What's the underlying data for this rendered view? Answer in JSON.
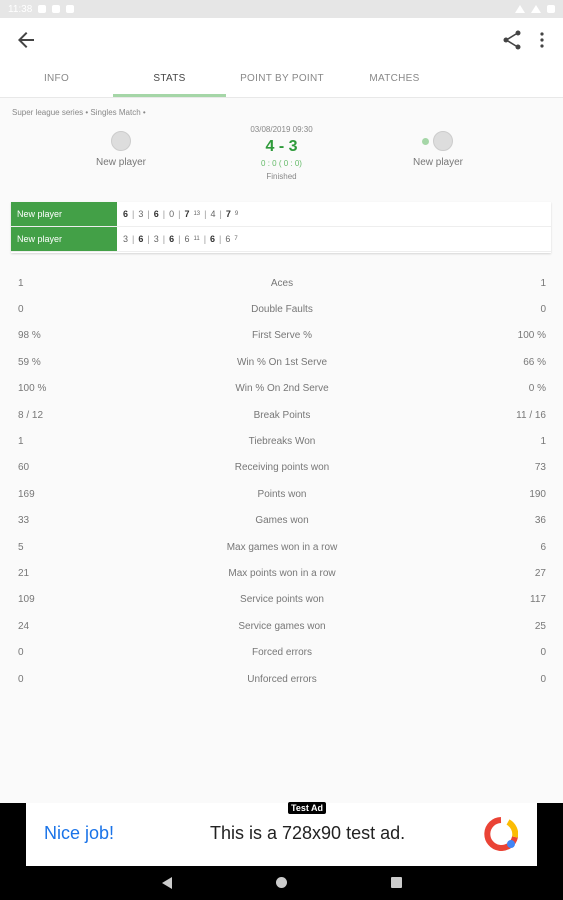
{
  "status_bar": {
    "time": "11:38"
  },
  "tabs": [
    "INFO",
    "STATS",
    "POINT BY POINT",
    "MATCHES"
  ],
  "breadcrumb": "Super league series • Singles Match •",
  "match": {
    "date": "03/08/2019 09:30",
    "score": "4 - 3",
    "subscore": "0 : 0 ( 0 : 0)",
    "status": "Finished",
    "player1": "New player",
    "player2": "New player"
  },
  "sets": [
    {
      "name": "New player",
      "games": [
        "6",
        "3",
        "6",
        "0",
        "7",
        "4",
        "7"
      ],
      "tiebreaks": {
        "4": "13",
        "6": "9"
      },
      "bold": [
        0,
        2,
        4,
        6
      ]
    },
    {
      "name": "New player",
      "games": [
        "3",
        "6",
        "3",
        "6",
        "6",
        "6",
        "6"
      ],
      "tiebreaks": {
        "4": "11",
        "6": "7"
      },
      "bold": [
        1,
        3,
        5
      ]
    }
  ],
  "stats": [
    {
      "label": "Aces",
      "left": "1",
      "right": "1"
    },
    {
      "label": "Double Faults",
      "left": "0",
      "right": "0"
    },
    {
      "label": "First Serve %",
      "left": "98 %",
      "right": "100 %"
    },
    {
      "label": "Win % On 1st Serve",
      "left": "59 %",
      "right": "66 %"
    },
    {
      "label": "Win % On 2nd Serve",
      "left": "100 %",
      "right": "0 %"
    },
    {
      "label": "Break Points",
      "left": "8 / 12",
      "right": "11 / 16"
    },
    {
      "label": "Tiebreaks Won",
      "left": "1",
      "right": "1"
    },
    {
      "label": "Receiving points won",
      "left": "60",
      "right": "73"
    },
    {
      "label": "Points won",
      "left": "169",
      "right": "190"
    },
    {
      "label": "Games won",
      "left": "33",
      "right": "36"
    },
    {
      "label": "Max games won in a row",
      "left": "5",
      "right": "6"
    },
    {
      "label": "Max points won in a row",
      "left": "21",
      "right": "27"
    },
    {
      "label": "Service points won",
      "left": "109",
      "right": "117"
    },
    {
      "label": "Service games won",
      "left": "24",
      "right": "25"
    },
    {
      "label": "Forced errors",
      "left": "0",
      "right": "0"
    },
    {
      "label": "Unforced errors",
      "left": "0",
      "right": "0"
    }
  ],
  "ad": {
    "label": "Test Ad",
    "cta": "Nice job!",
    "text": "This is a 728x90 test ad."
  },
  "colors": {
    "accent": "#43a047",
    "score": "#2e9a3a"
  }
}
